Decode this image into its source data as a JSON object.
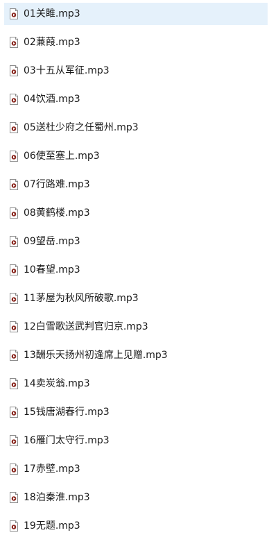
{
  "colors": {
    "selected_background": "#e5f1fb",
    "icon_badge": "#8b2a22"
  },
  "files": [
    {
      "name": "01关雎.mp3",
      "icon": "media-file-icon",
      "selected": true
    },
    {
      "name": "02蒹葭.mp3",
      "icon": "media-file-icon"
    },
    {
      "name": "03十五从军征.mp3",
      "icon": "media-file-icon"
    },
    {
      "name": "04饮酒.mp3",
      "icon": "media-file-icon"
    },
    {
      "name": "05送杜少府之任蜀州.mp3",
      "icon": "media-file-icon"
    },
    {
      "name": "06使至塞上.mp3",
      "icon": "media-file-icon"
    },
    {
      "name": "07行路难.mp3",
      "icon": "media-file-icon"
    },
    {
      "name": "08黄鹤楼.mp3",
      "icon": "media-file-icon"
    },
    {
      "name": "09望岳.mp3",
      "icon": "media-file-icon"
    },
    {
      "name": "10春望.mp3",
      "icon": "media-file-icon"
    },
    {
      "name": "11茅屋为秋风所破歌.mp3",
      "icon": "media-file-icon"
    },
    {
      "name": "12白雪歌送武判官归京.mp3",
      "icon": "media-file-icon"
    },
    {
      "name": "13酬乐天扬州初逢席上见赠.mp3",
      "icon": "media-file-icon"
    },
    {
      "name": "14卖炭翁.mp3",
      "icon": "media-file-icon"
    },
    {
      "name": "15钱唐湖春行.mp3",
      "icon": "media-file-icon"
    },
    {
      "name": "16雁门太守行.mp3",
      "icon": "media-file-icon"
    },
    {
      "name": "17赤壁.mp3",
      "icon": "media-file-icon"
    },
    {
      "name": "18泊秦淮.mp3",
      "icon": "media-file-icon"
    },
    {
      "name": "19无题.mp3",
      "icon": "media-file-icon"
    }
  ]
}
